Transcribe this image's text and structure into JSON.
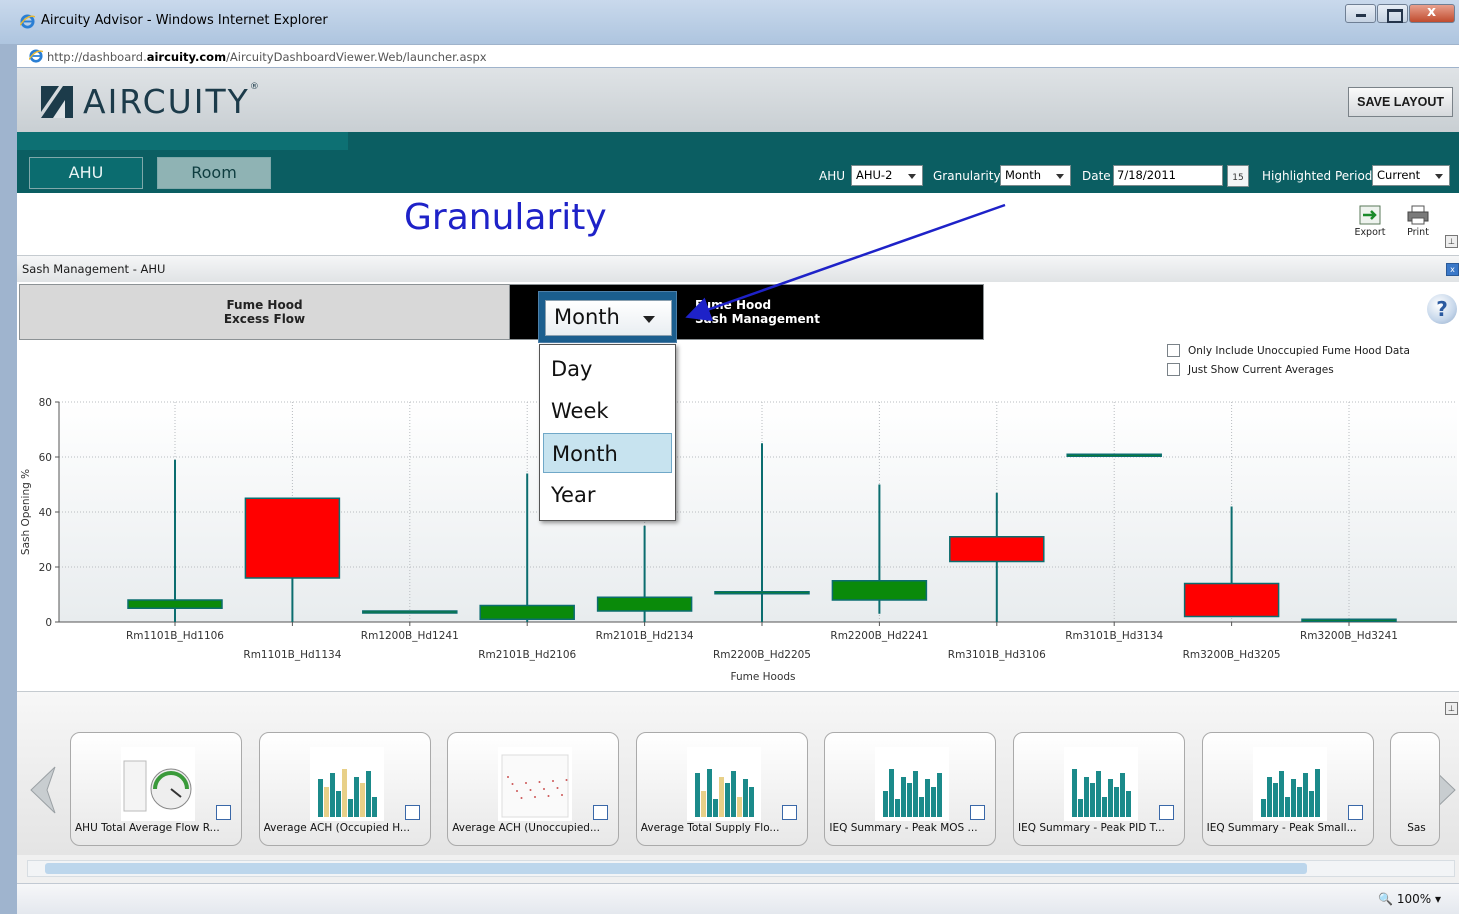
{
  "window": {
    "title": "Aircuity Advisor - Windows Internet Explorer",
    "url_prefix": "http://dashboard.",
    "url_domain": "aircuity.com",
    "url_suffix": "/AircuityDashboardViewer.Web/launcher.aspx"
  },
  "header": {
    "logo_text": "AIRCUITY",
    "save_layout_label": "SAVE LAYOUT"
  },
  "tabs": {
    "ahu": "AHU",
    "room": "Room"
  },
  "controls": {
    "ahu_label": "AHU",
    "ahu_value": "AHU-2",
    "granularity_label": "Granularity",
    "granularity_value": "Month",
    "date_label": "Date",
    "date_value": "7/18/2011",
    "calendar_day": "15",
    "highlighted_period_label": "Highlighted Period",
    "highlighted_period_value": "Current"
  },
  "annotation": "Granularity",
  "tools": {
    "export": "Export",
    "print": "Print"
  },
  "panel": {
    "title": "Sash Management - AHU",
    "tab_excess_line1": "Fume Hood",
    "tab_excess_line2": "Excess Flow",
    "tab_sash_line1": "Fume Hood",
    "tab_sash_line2": "Sash Management",
    "only_unoccupied": "Only Include Unoccupied Fume Hood Data",
    "just_current": "Just Show Current Averages"
  },
  "dropdown": {
    "selected": "Month",
    "options": [
      "Day",
      "Week",
      "Month",
      "Year"
    ]
  },
  "chart_data": {
    "type": "candlestick",
    "xlabel": "Fume Hoods",
    "ylabel": "Sash Opening %",
    "ylim": [
      0,
      80
    ],
    "yticks": [
      0,
      20,
      40,
      60,
      80
    ],
    "grid": true,
    "categories": [
      "Rm1101B_Hd1106",
      "Rm1101B_Hd1134",
      "Rm1200B_Hd1241",
      "Rm2101B_Hd2106",
      "Rm2101B_Hd2134",
      "Rm2200B_Hd2205",
      "Rm2200B_Hd2241",
      "Rm3101B_Hd3106",
      "Rm3101B_Hd3134",
      "Rm3200B_Hd3205",
      "Rm3200B_Hd3241"
    ],
    "series": [
      {
        "low": 0,
        "box_low": 5,
        "box_high": 8,
        "high": 59,
        "color": "#0a8a0a"
      },
      {
        "low": 0,
        "box_low": 16,
        "box_high": 45,
        "high": 45,
        "color": "#ff0000"
      },
      {
        "low": 4,
        "box_low": 4,
        "box_high": 4,
        "high": 4,
        "color": "#0a8a0a"
      },
      {
        "low": 0,
        "box_low": 1,
        "box_high": 6,
        "high": 54,
        "color": "#0a8a0a"
      },
      {
        "low": 0,
        "box_low": 4,
        "box_high": 9,
        "high": 35,
        "color": "#0a8a0a"
      },
      {
        "low": 0,
        "box_low": 11,
        "box_high": 11,
        "high": 65,
        "color": "#0a8a0a"
      },
      {
        "low": 3,
        "box_low": 8,
        "box_high": 15,
        "high": 50,
        "color": "#0a8a0a"
      },
      {
        "low": 0,
        "box_low": 22,
        "box_high": 31,
        "high": 47,
        "color": "#ff0000"
      },
      {
        "low": 61,
        "box_low": 61,
        "box_high": 61,
        "high": 61,
        "color": "#0a8a0a"
      },
      {
        "low": 2,
        "box_low": 2,
        "box_high": 14,
        "high": 42,
        "color": "#ff0000"
      },
      {
        "low": 1,
        "box_low": 1,
        "box_high": 1,
        "high": 1,
        "color": "#0a8a0a"
      }
    ]
  },
  "carousel": {
    "cards": [
      "AHU Total Average Flow R...",
      "Average ACH (Occupied H...",
      "Average ACH (Unoccupied...",
      "Average Total Supply Flo...",
      "IEQ Summary - Peak MOS ...",
      "IEQ Summary - Peak PID T...",
      "IEQ Summary - Peak Small...",
      "Sas"
    ]
  },
  "status": {
    "zoom": "100%"
  },
  "colors": {
    "teal": "#0b5e62",
    "annotation_blue": "#1e22c8",
    "box_green": "#0a8a0a",
    "box_red": "#ff0000",
    "whisker": "#0b6d6f"
  }
}
